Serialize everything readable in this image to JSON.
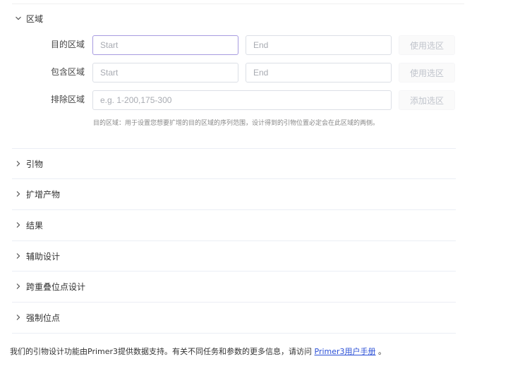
{
  "sections": {
    "region": {
      "title": "区域",
      "rows": {
        "target": {
          "label": "目的区域",
          "start_placeholder": "Start",
          "end_placeholder": "End",
          "button": "使用选区"
        },
        "include": {
          "label": "包含区域",
          "start_placeholder": "Start",
          "end_placeholder": "End",
          "button": "使用选区"
        },
        "exclude": {
          "label": "排除区域",
          "placeholder": "e.g. 1-200,175-300",
          "button": "添加选区"
        }
      },
      "hint": "目的区域：用于设置您想要扩增的目的区域的序列范围，设计得到的引物位置必定会在此区域的两侧。"
    },
    "primers": {
      "title": "引物"
    },
    "amplicon": {
      "title": "扩增产物"
    },
    "results": {
      "title": "结果"
    },
    "assist": {
      "title": "辅助设计"
    },
    "overlap": {
      "title": "跨重叠位点设计"
    },
    "forced": {
      "title": "强制位点"
    }
  },
  "footer": {
    "text_before": "我们的引物设计功能由Primer3提供数据支持。有关不同任务和参数的更多信息，请访问 ",
    "link": "Primer3用户手册",
    "text_after": " 。"
  },
  "icons": {
    "expanded": "chevron-down-icon",
    "collapsed": "chevron-right-icon"
  },
  "colors": {
    "focus_border": "#a79be0",
    "link": "#2a4fd6",
    "disabled_text": "#c0c4cc"
  }
}
